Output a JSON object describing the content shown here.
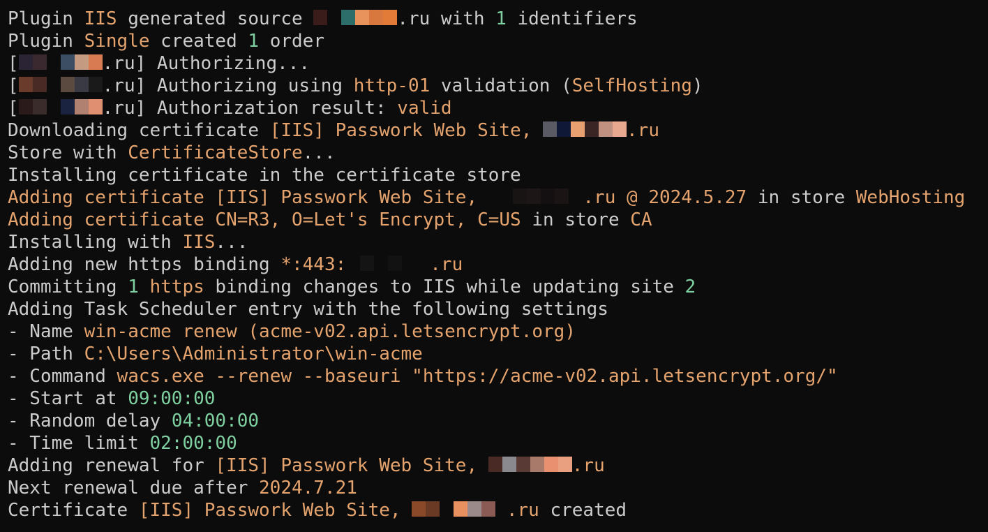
{
  "terminal": {
    "lines": [
      {
        "segments": [
          {
            "text": "Plugin ",
            "color": "white"
          },
          {
            "text": "IIS",
            "color": "orange"
          },
          {
            "text": " generated source ",
            "color": "white"
          },
          {
            "redacted": [
              "#3a1c1a",
              "#0c0c0c",
              "#2e6e6a",
              "#e8935c",
              "#d9783e",
              "#e27a38"
            ]
          },
          {
            "text": ".ru with ",
            "color": "white"
          },
          {
            "text": "1",
            "color": "green"
          },
          {
            "text": " identifiers",
            "color": "white"
          }
        ]
      },
      {
        "segments": [
          {
            "text": "Plugin ",
            "color": "white"
          },
          {
            "text": "Single",
            "color": "orange"
          },
          {
            "text": " created ",
            "color": "white"
          },
          {
            "text": "1",
            "color": "green"
          },
          {
            "text": " order",
            "color": "white"
          }
        ]
      },
      {
        "segments": [
          {
            "text": "[",
            "color": "white"
          },
          {
            "redacted": [
              "#2a2434",
              "#3a2a30",
              "#0c0c0c",
              "#3c4e64",
              "#c49a80",
              "#d87a52"
            ]
          },
          {
            "text": ".ru] Authorizing...",
            "color": "white"
          }
        ]
      },
      {
        "segments": [
          {
            "text": "[",
            "color": "white"
          },
          {
            "redacted": [
              "#6a3a2a",
              "#4a2a24",
              "#0c0c0c",
              "#5a4a40",
              "#3a3a44",
              "#1a1a1a"
            ]
          },
          {
            "text": ".ru] Authorizing using ",
            "color": "white"
          },
          {
            "text": "http-01",
            "color": "orange"
          },
          {
            "text": " validation (",
            "color": "white"
          },
          {
            "text": "SelfHosting",
            "color": "orange"
          },
          {
            "text": ")",
            "color": "white"
          }
        ]
      },
      {
        "segments": [
          {
            "text": "[",
            "color": "white"
          },
          {
            "redacted": [
              "#2a1a1a",
              "#3a2c2a",
              "#0c0c0c",
              "#1a2440",
              "#b08070",
              "#e09070"
            ]
          },
          {
            "text": ".ru] Authorization result: ",
            "color": "white"
          },
          {
            "text": "valid",
            "color": "orange"
          }
        ]
      },
      {
        "segments": [
          {
            "text": "Downloading certificate ",
            "color": "white"
          },
          {
            "text": "[IIS] Passwork Web Site, ",
            "color": "orange"
          },
          {
            "redacted": [
              "#5a5a64",
              "#101838",
              "#e8a070",
              "#3a2424",
              "#c09080",
              "#e8a890"
            ]
          },
          {
            "text": ".ru",
            "color": "orange"
          }
        ]
      },
      {
        "segments": [
          {
            "text": "Store with ",
            "color": "white"
          },
          {
            "text": "CertificateStore",
            "color": "orange"
          },
          {
            "text": "...",
            "color": "white"
          }
        ]
      },
      {
        "segments": [
          {
            "text": "Installing certificate in the certificate store",
            "color": "white"
          }
        ]
      },
      {
        "segments": [
          {
            "text": "Adding certificate [IIS] Passwork Web Site,",
            "color": "orange"
          },
          {
            "text": "  ",
            "color": "white"
          },
          {
            "redacted": [
              "#0c0c0c",
              "#181414",
              "#1c1616",
              "#141012",
              "#1a1414",
              "#0c0c0c"
            ]
          },
          {
            "text": ".ru @ 2024.5.27",
            "color": "orange"
          },
          {
            "text": " in store ",
            "color": "white"
          },
          {
            "text": "WebHosting",
            "color": "orange"
          }
        ]
      },
      {
        "segments": [
          {
            "text": "Adding certificate CN=R3, O=Let's Encrypt, C=US",
            "color": "orange"
          },
          {
            "text": " in store ",
            "color": "white"
          },
          {
            "text": "CA",
            "color": "orange"
          }
        ]
      },
      {
        "segments": [
          {
            "text": "Installing with ",
            "color": "white"
          },
          {
            "text": "IIS",
            "color": "orange"
          },
          {
            "text": "...",
            "color": "white"
          }
        ]
      },
      {
        "segments": [
          {
            "text": "Adding new https binding ",
            "color": "white"
          },
          {
            "text": "*:443:",
            "color": "orange"
          },
          {
            "redacted": [
              "#0c0c0c",
              "#141414",
              "#0c0c0c",
              "#121212",
              "#0c0c0c",
              "#0c0c0c"
            ]
          },
          {
            "text": ".ru",
            "color": "orange"
          }
        ]
      },
      {
        "segments": [
          {
            "text": "Committing ",
            "color": "white"
          },
          {
            "text": "1",
            "color": "green"
          },
          {
            "text": " ",
            "color": "white"
          },
          {
            "text": "https",
            "color": "orange"
          },
          {
            "text": " binding changes to IIS while updating site ",
            "color": "white"
          },
          {
            "text": "2",
            "color": "green"
          }
        ]
      },
      {
        "segments": [
          {
            "text": "Adding Task Scheduler entry with the following settings",
            "color": "white"
          }
        ]
      },
      {
        "segments": [
          {
            "text": "- Name ",
            "color": "white"
          },
          {
            "text": "win-acme renew (acme-v02.api.letsencrypt.org)",
            "color": "orange"
          }
        ]
      },
      {
        "segments": [
          {
            "text": "- Path ",
            "color": "white"
          },
          {
            "text": "C:\\Users\\Administrator\\win-acme",
            "color": "orange"
          }
        ]
      },
      {
        "segments": [
          {
            "text": "- Command ",
            "color": "white"
          },
          {
            "text": "wacs.exe --renew --baseuri \"https://acme-v02.api.letsencrypt.org/\"",
            "color": "orange"
          }
        ]
      },
      {
        "segments": [
          {
            "text": "- Start at ",
            "color": "white"
          },
          {
            "text": "09:00:00",
            "color": "green"
          }
        ]
      },
      {
        "segments": [
          {
            "text": "- Random delay ",
            "color": "white"
          },
          {
            "text": "04:00:00",
            "color": "green"
          }
        ]
      },
      {
        "segments": [
          {
            "text": "- Time limit ",
            "color": "white"
          },
          {
            "text": "02:00:00",
            "color": "green"
          }
        ]
      },
      {
        "segments": [
          {
            "text": "Adding renewal for ",
            "color": "white"
          },
          {
            "text": "[IIS] Passwork Web Site, ",
            "color": "orange"
          },
          {
            "redacted": [
              "#4a2a24",
              "#8a8a8e",
              "#5a3a34",
              "#a87a6a",
              "#e89070",
              "#e8a080"
            ]
          },
          {
            "text": ".ru",
            "color": "orange"
          }
        ]
      },
      {
        "segments": [
          {
            "text": "Next renewal due after ",
            "color": "white"
          },
          {
            "text": "2024.7.21",
            "color": "orange"
          }
        ]
      },
      {
        "segments": [
          {
            "text": "Certificate ",
            "color": "white"
          },
          {
            "text": "[IIS] Passwork Web Site, ",
            "color": "orange"
          },
          {
            "redacted": [
              "#8a4a2a",
              "#6a3a24",
              "#0c0c0c",
              "#e89060",
              "#9a8a8a",
              "#8a5a54"
            ]
          },
          {
            "text": " .ru",
            "color": "orange"
          },
          {
            "text": " created",
            "color": "white"
          }
        ]
      }
    ]
  }
}
